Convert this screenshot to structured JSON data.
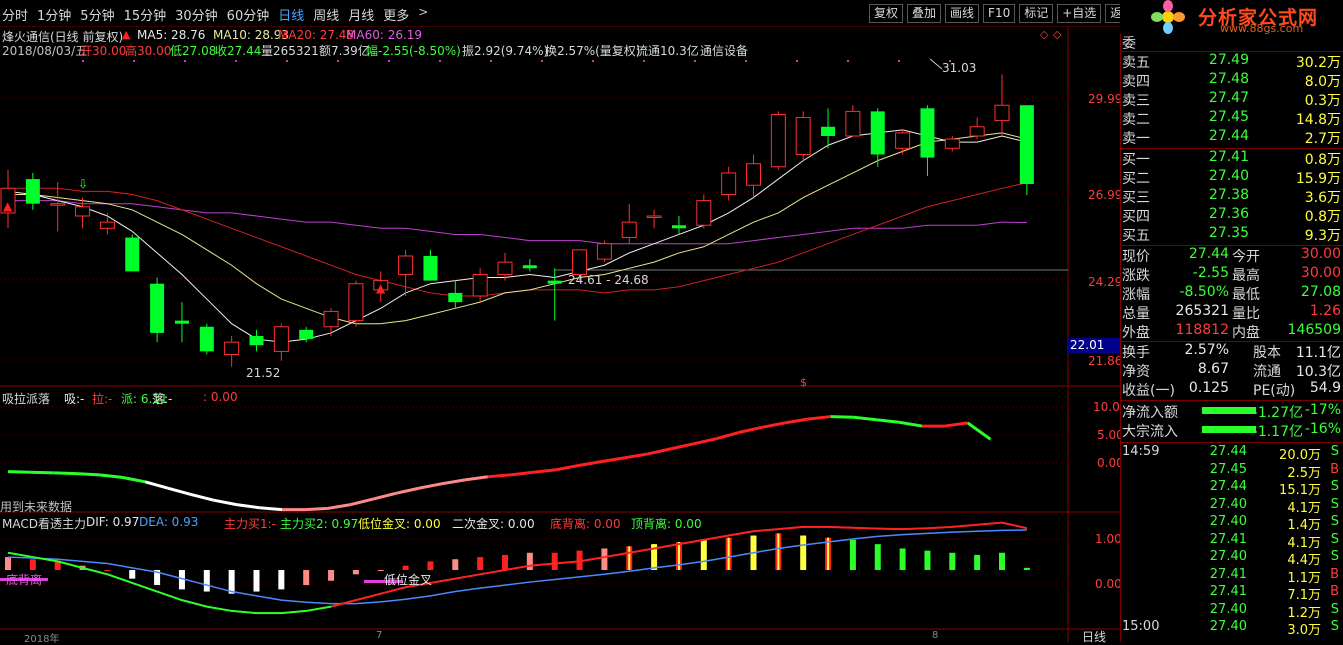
{
  "toolbar": {
    "periods": [
      "分时",
      "1分钟",
      "5分钟",
      "15分钟",
      "30分钟",
      "60分钟",
      "日线",
      "周线",
      "月线",
      "更多"
    ],
    "active_period": "日线",
    "more_chevron": ">",
    "buttons": [
      "复权",
      "叠加",
      "画线",
      "F10",
      "标记",
      "+自选",
      "返回"
    ]
  },
  "stock_header": {
    "name": "烽火通信(日线 前复权)",
    "ma5": "MA5: 28.76",
    "ma10": "MA10: 28.93",
    "ma20": "MA20: 27.48",
    "ma60": "MA60: 26.19",
    "info_line": {
      "date": "2018/08/03/五",
      "open": "开30.00",
      "high": "高30.00",
      "low": "低27.08",
      "close": "收27.44",
      "volume": "量265321",
      "amount": "额7.39亿",
      "change": "幅-2.55(-8.50%)",
      "amplitude": "振2.92(9.74%)",
      "turnover": "换2.57%(量复权)",
      "float": "流通10.3亿",
      "industry": "通信设备"
    }
  },
  "price_axis": {
    "labels": [
      "29.99",
      "26.99",
      "24.29",
      "21.86"
    ],
    "current_tag": "22.01"
  },
  "annotations": {
    "high_label": "31.03",
    "low_label": "21.52",
    "range_label": "24.61 - 24.68",
    "dollar_mark": "$"
  },
  "indicator1": {
    "title": "吸拉派落",
    "xi": "吸:-",
    "la": "拉:-",
    "pai": "派: 6.11",
    "luo": "落:-",
    "val": ": 0.00",
    "footer": "用到未来数据",
    "axis": [
      "10.00",
      "5.00",
      "0.00"
    ]
  },
  "indicator2": {
    "title": "MACD看透主力",
    "dif": "DIF: 0.97",
    "dea": "DEA: 0.93",
    "zl1": "主力买1:-",
    "zl2": "主力买2: 0.97",
    "dwjc": "低位金叉: 0.00",
    "ecjc": "二次金叉: 0.00",
    "dbl": "底背离: 0.00",
    "dbl2": "顶背离: 0.00",
    "left_mark": "底背离",
    "mid_mark": "低位金叉",
    "axis": [
      "1.00",
      "0.00"
    ]
  },
  "bottom_bar": {
    "x_marks": [
      "2018年",
      "7",
      "8"
    ],
    "period_label": "日线"
  },
  "side": {
    "brand": "分析家公式网",
    "site": "www.88gs.com",
    "weibi_label": "委",
    "asks": [
      {
        "label": "卖五",
        "price": "27.49",
        "vol": "30.2万"
      },
      {
        "label": "卖四",
        "price": "27.48",
        "vol": "8.0万"
      },
      {
        "label": "卖三",
        "price": "27.47",
        "vol": "0.3万"
      },
      {
        "label": "卖二",
        "price": "27.45",
        "vol": "14.8万"
      },
      {
        "label": "卖一",
        "price": "27.44",
        "vol": "2.7万"
      }
    ],
    "bids": [
      {
        "label": "买一",
        "price": "27.41",
        "vol": "0.8万"
      },
      {
        "label": "买二",
        "price": "27.40",
        "vol": "15.9万"
      },
      {
        "label": "买三",
        "price": "27.38",
        "vol": "3.6万"
      },
      {
        "label": "买四",
        "price": "27.36",
        "vol": "0.8万"
      },
      {
        "label": "买五",
        "price": "27.35",
        "vol": "9.3万"
      }
    ],
    "quote": [
      {
        "l1": "现价",
        "v1": "27.44",
        "c1": "green",
        "l2": "今开",
        "v2": "30.00",
        "c2": "red"
      },
      {
        "l1": "涨跌",
        "v1": "-2.55",
        "c1": "green",
        "l2": "最高",
        "v2": "30.00",
        "c2": "red"
      },
      {
        "l1": "涨幅",
        "v1": "-8.50%",
        "c1": "green",
        "l2": "最低",
        "v2": "27.08",
        "c2": "green"
      },
      {
        "l1": "总量",
        "v1": "265321",
        "c1": "white",
        "l2": "量比",
        "v2": "1.26",
        "c2": "red"
      },
      {
        "l1": "外盘",
        "v1": "118812",
        "c1": "red",
        "l2": "内盘",
        "v2": "146509",
        "c2": "green"
      }
    ],
    "quote2": [
      {
        "l1": "换手",
        "v1": "2.57%",
        "l2": "股本",
        "v2": "11.1亿"
      },
      {
        "l1": "净资",
        "v1": "8.67",
        "l2": "流通",
        "v2": "10.3亿"
      },
      {
        "l1": "收益(一)",
        "v1": "0.125",
        "l2": "PE(动)",
        "v2": "54.9"
      }
    ],
    "flows": [
      {
        "label": "净流入额",
        "value": "-1.27亿",
        "pct": "-17%"
      },
      {
        "label": "大宗流入",
        "value": "-1.17亿",
        "pct": "-16%"
      }
    ],
    "ticks": [
      {
        "time": "14:59",
        "price": "27.44",
        "vol": "20.0万",
        "bs": "S"
      },
      {
        "time": "",
        "price": "27.45",
        "vol": "2.5万",
        "bs": "B"
      },
      {
        "time": "",
        "price": "27.44",
        "vol": "15.1万",
        "bs": "S"
      },
      {
        "time": "",
        "price": "27.40",
        "vol": "4.1万",
        "bs": "S"
      },
      {
        "time": "",
        "price": "27.40",
        "vol": "1.4万",
        "bs": "S"
      },
      {
        "time": "",
        "price": "27.41",
        "vol": "4.1万",
        "bs": "S"
      },
      {
        "time": "",
        "price": "27.40",
        "vol": "4.4万",
        "bs": "S"
      },
      {
        "time": "",
        "price": "27.41",
        "vol": "1.1万",
        "bs": "B"
      },
      {
        "time": "",
        "price": "27.41",
        "vol": "7.1万",
        "bs": "B"
      },
      {
        "time": "",
        "price": "27.40",
        "vol": "1.2万",
        "bs": "S"
      },
      {
        "time": "15:00",
        "price": "27.40",
        "vol": "3.0万",
        "bs": "S"
      }
    ]
  },
  "chart_data": {
    "type": "candlestick",
    "candles": [
      {
        "o": 26.5,
        "h": 27.9,
        "l": 26.0,
        "c": 27.3
      },
      {
        "o": 27.6,
        "h": 27.8,
        "l": 26.6,
        "c": 26.8
      },
      {
        "o": 26.8,
        "h": 27.5,
        "l": 25.9,
        "c": 26.8
      },
      {
        "o": 26.4,
        "h": 27.0,
        "l": 26.0,
        "c": 26.7
      },
      {
        "o": 26.0,
        "h": 26.5,
        "l": 25.8,
        "c": 26.2
      },
      {
        "o": 25.7,
        "h": 25.8,
        "l": 24.7,
        "c": 24.6
      },
      {
        "o": 24.2,
        "h": 24.4,
        "l": 22.3,
        "c": 22.6
      },
      {
        "o": 23.0,
        "h": 23.6,
        "l": 22.3,
        "c": 22.9
      },
      {
        "o": 22.8,
        "h": 22.9,
        "l": 21.9,
        "c": 22.0
      },
      {
        "o": 21.9,
        "h": 22.5,
        "l": 21.5,
        "c": 22.3
      },
      {
        "o": 22.5,
        "h": 22.7,
        "l": 22.0,
        "c": 22.2
      },
      {
        "o": 22.0,
        "h": 22.9,
        "l": 21.7,
        "c": 22.8
      },
      {
        "o": 22.7,
        "h": 22.8,
        "l": 22.3,
        "c": 22.4
      },
      {
        "o": 22.8,
        "h": 23.4,
        "l": 22.5,
        "c": 23.3
      },
      {
        "o": 23.0,
        "h": 24.3,
        "l": 22.8,
        "c": 24.2
      },
      {
        "o": 24.0,
        "h": 24.6,
        "l": 23.6,
        "c": 24.3
      },
      {
        "o": 24.5,
        "h": 25.3,
        "l": 23.8,
        "c": 25.1
      },
      {
        "o": 25.1,
        "h": 25.3,
        "l": 24.3,
        "c": 24.3
      },
      {
        "o": 23.9,
        "h": 24.3,
        "l": 23.4,
        "c": 23.6
      },
      {
        "o": 23.8,
        "h": 24.7,
        "l": 23.6,
        "c": 24.5
      },
      {
        "o": 24.5,
        "h": 25.2,
        "l": 24.3,
        "c": 24.9
      },
      {
        "o": 24.8,
        "h": 25.0,
        "l": 24.6,
        "c": 24.7
      },
      {
        "o": 24.3,
        "h": 24.7,
        "l": 23.0,
        "c": 24.2
      },
      {
        "o": 24.5,
        "h": 25.2,
        "l": 24.3,
        "c": 25.3
      },
      {
        "o": 25.0,
        "h": 25.6,
        "l": 24.9,
        "c": 25.5
      },
      {
        "o": 25.7,
        "h": 26.8,
        "l": 25.5,
        "c": 26.2
      },
      {
        "o": 26.4,
        "h": 26.6,
        "l": 26.0,
        "c": 26.4
      },
      {
        "o": 26.1,
        "h": 26.4,
        "l": 25.8,
        "c": 26.0
      },
      {
        "o": 26.1,
        "h": 27.1,
        "l": 26.0,
        "c": 26.9
      },
      {
        "o": 27.1,
        "h": 28.0,
        "l": 26.9,
        "c": 27.8
      },
      {
        "o": 27.4,
        "h": 28.4,
        "l": 27.0,
        "c": 28.1
      },
      {
        "o": 28.0,
        "h": 29.8,
        "l": 27.9,
        "c": 29.7
      },
      {
        "o": 28.4,
        "h": 29.8,
        "l": 28.2,
        "c": 29.6
      },
      {
        "o": 29.3,
        "h": 29.9,
        "l": 28.6,
        "c": 29.0
      },
      {
        "o": 29.0,
        "h": 30.0,
        "l": 29.0,
        "c": 29.8
      },
      {
        "o": 29.8,
        "h": 29.9,
        "l": 28.0,
        "c": 28.4
      },
      {
        "o": 28.6,
        "h": 29.2,
        "l": 28.4,
        "c": 29.1
      },
      {
        "o": 29.9,
        "h": 30.0,
        "l": 27.7,
        "c": 28.3
      },
      {
        "o": 28.6,
        "h": 29.0,
        "l": 28.5,
        "c": 28.9
      },
      {
        "o": 29.0,
        "h": 29.6,
        "l": 28.9,
        "c": 29.3
      },
      {
        "o": 29.5,
        "h": 31.0,
        "l": 29.0,
        "c": 30.0
      },
      {
        "o": 30.0,
        "h": 30.0,
        "l": 27.08,
        "c": 27.44
      }
    ],
    "ma5": [
      27.2,
      27.1,
      26.9,
      26.7,
      26.4,
      25.9,
      25.2,
      24.5,
      23.7,
      22.9,
      22.4,
      22.3,
      22.4,
      22.6,
      23.0,
      23.4,
      23.9,
      24.2,
      24.3,
      24.4,
      24.4,
      24.5,
      24.4,
      24.6,
      24.8,
      25.2,
      25.5,
      25.8,
      26.1,
      26.5,
      27.0,
      27.6,
      28.2,
      28.7,
      29.0,
      29.1,
      29.2,
      29.0,
      28.8,
      28.8,
      29.0,
      28.8
    ],
    "ma10": [
      27.1,
      27.1,
      27.0,
      26.9,
      26.8,
      26.6,
      26.2,
      25.8,
      25.3,
      24.8,
      24.2,
      23.7,
      23.4,
      23.1,
      22.9,
      22.9,
      23.0,
      23.2,
      23.4,
      23.6,
      23.9,
      24.0,
      24.2,
      24.4,
      24.5,
      24.7,
      24.9,
      25.2,
      25.4,
      25.8,
      26.2,
      26.5,
      27.0,
      27.4,
      27.8,
      28.2,
      28.5,
      28.8,
      28.9,
      29.0,
      29.1,
      28.9
    ],
    "ma20": [
      27.3,
      27.3,
      27.3,
      27.2,
      27.2,
      27.1,
      26.9,
      26.6,
      26.3,
      26.0,
      25.7,
      25.4,
      25.1,
      24.8,
      24.5,
      24.3,
      24.1,
      23.9,
      23.8,
      23.8,
      23.9,
      24.0,
      24.0,
      24.0,
      23.9,
      24.0,
      24.0,
      24.1,
      24.3,
      24.5,
      24.7,
      24.9,
      25.2,
      25.5,
      25.8,
      26.1,
      26.4,
      26.7,
      26.9,
      27.1,
      27.3,
      27.48
    ],
    "ma60": [
      26.9,
      26.9,
      26.9,
      26.8,
      26.8,
      26.8,
      26.7,
      26.6,
      26.5,
      26.5,
      26.4,
      26.3,
      26.2,
      26.2,
      26.1,
      26.0,
      26.0,
      25.9,
      25.8,
      25.8,
      25.7,
      25.6,
      25.6,
      25.6,
      25.5,
      25.5,
      25.5,
      25.5,
      25.5,
      25.5,
      25.6,
      25.7,
      25.8,
      25.9,
      26.0,
      26.0,
      26.0,
      26.1,
      26.1,
      26.1,
      26.2,
      26.19
    ],
    "ylim": [
      21.2,
      31.6
    ],
    "indicator1_line": [
      1.0,
      0.9,
      0.8,
      0.7,
      0.5,
      0.1,
      -0.6,
      -1.6,
      -2.6,
      -3.5,
      -4.2,
      -4.7,
      -5.0,
      -5.0,
      -4.8,
      -4.2,
      -3.3,
      -2.4,
      -1.6,
      -0.9,
      -0.3,
      0.2,
      0.5,
      0.9,
      1.3,
      2.0,
      2.6,
      3.2,
      3.8,
      4.6,
      5.4,
      6.2,
      7.2,
      8.0,
      8.7,
      9.3,
      9.7,
      9.6,
      9.2,
      8.8,
      8.2,
      8.2,
      8.7,
      6.11
    ],
    "macd_hist": [
      0.3,
      0.25,
      0.2,
      0.1,
      0.0,
      -0.2,
      -0.35,
      -0.45,
      -0.5,
      -0.55,
      -0.5,
      -0.45,
      -0.35,
      -0.25,
      -0.1,
      0.0,
      0.1,
      0.2,
      0.25,
      0.3,
      0.35,
      0.4,
      0.4,
      0.45,
      0.5,
      0.55,
      0.6,
      0.65,
      0.7,
      0.75,
      0.8,
      0.85,
      0.8,
      0.75,
      0.7,
      0.6,
      0.5,
      0.45,
      0.4,
      0.35,
      0.4,
      0.05
    ],
    "dif": [
      0.4,
      0.3,
      0.2,
      0.05,
      -0.1,
      -0.3,
      -0.5,
      -0.7,
      -0.85,
      -0.95,
      -1.0,
      -1.0,
      -0.95,
      -0.85,
      -0.7,
      -0.55,
      -0.4,
      -0.3,
      -0.2,
      -0.1,
      0.0,
      0.1,
      0.15,
      0.2,
      0.3,
      0.4,
      0.5,
      0.6,
      0.7,
      0.8,
      0.9,
      0.95,
      1.0,
      1.0,
      0.98,
      0.96,
      0.95,
      0.97,
      1.0,
      1.05,
      1.1,
      0.97
    ],
    "dea": [
      0.3,
      0.28,
      0.25,
      0.2,
      0.15,
      0.05,
      -0.05,
      -0.2,
      -0.35,
      -0.5,
      -0.6,
      -0.7,
      -0.75,
      -0.78,
      -0.78,
      -0.74,
      -0.68,
      -0.6,
      -0.5,
      -0.42,
      -0.35,
      -0.28,
      -0.22,
      -0.16,
      -0.1,
      -0.03,
      0.05,
      0.12,
      0.2,
      0.3,
      0.4,
      0.5,
      0.58,
      0.65,
      0.72,
      0.78,
      0.82,
      0.85,
      0.88,
      0.9,
      0.92,
      0.93
    ],
    "indicator1_ylim": [
      -6,
      12
    ],
    "macd_ylim": [
      -1.3,
      1.3
    ]
  }
}
